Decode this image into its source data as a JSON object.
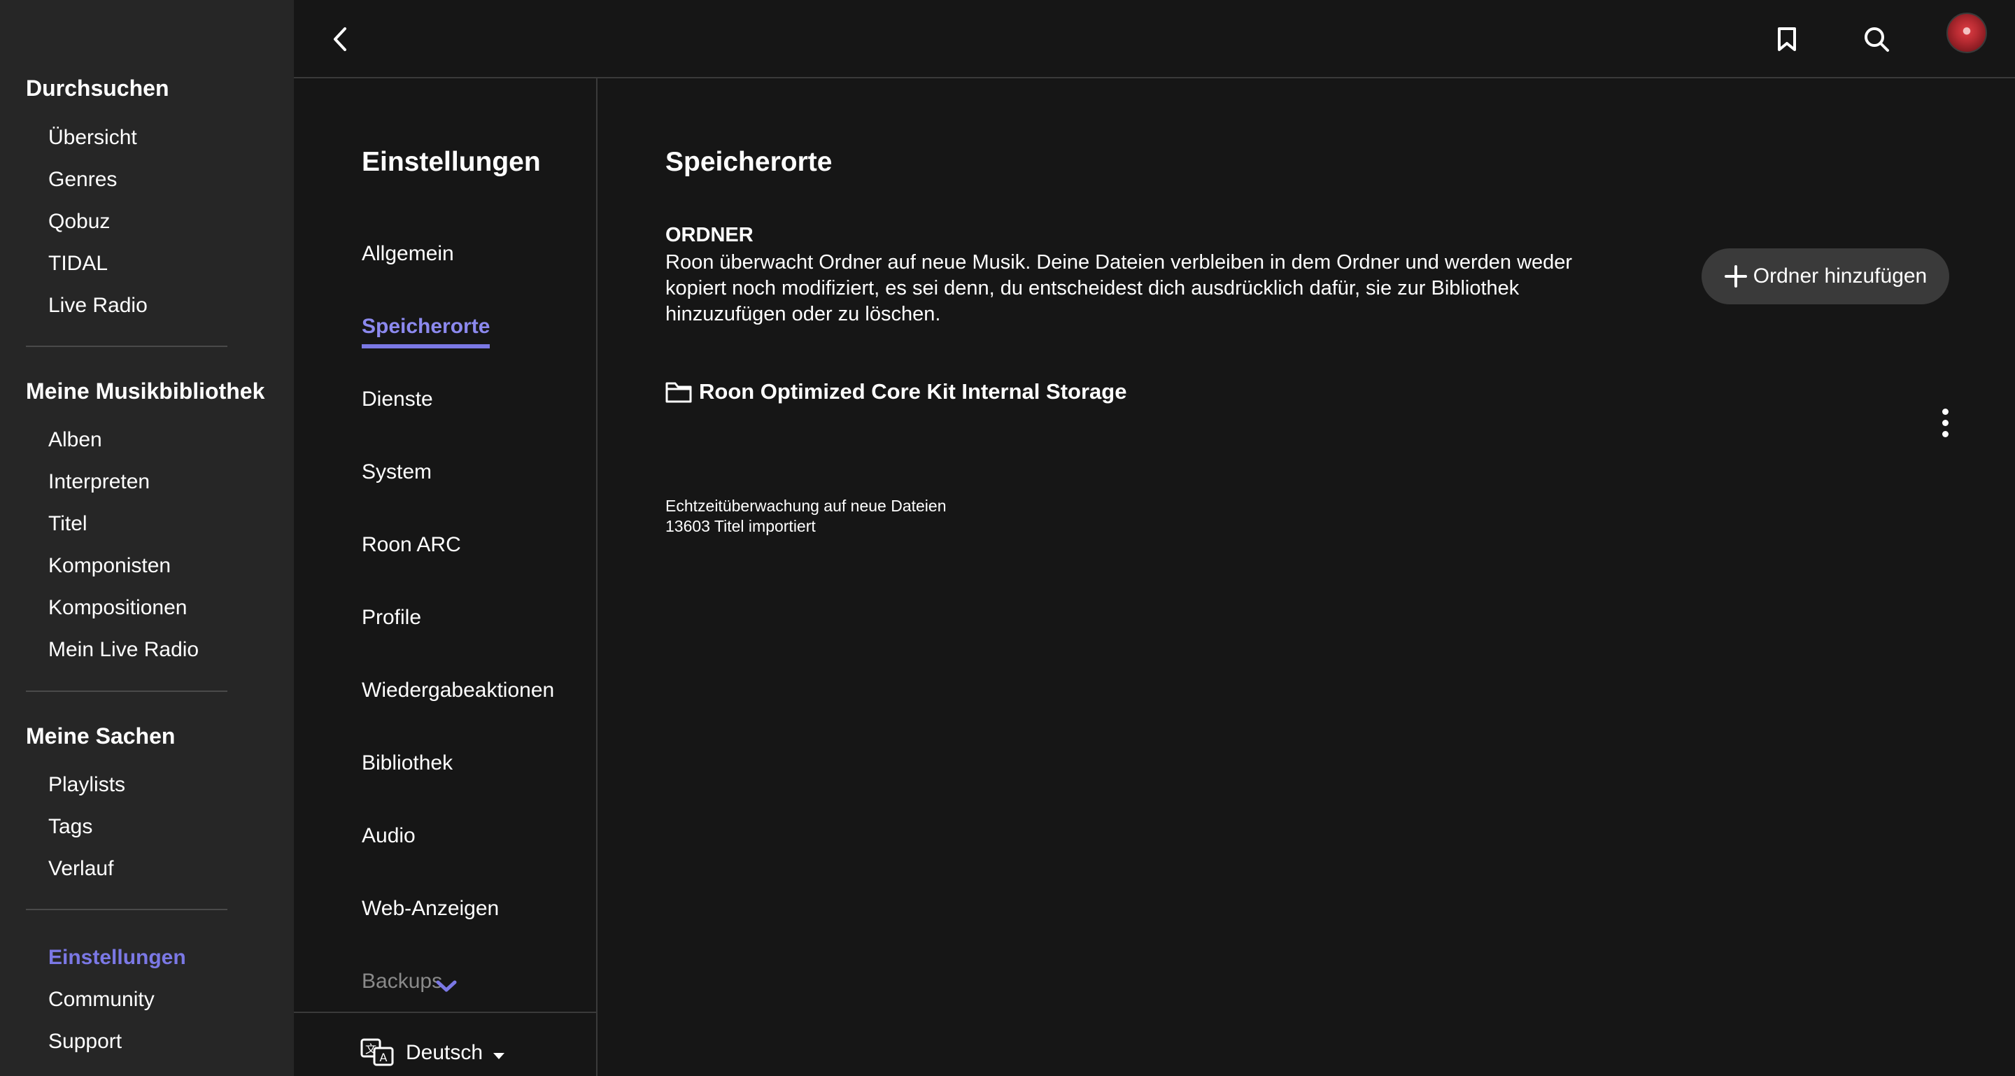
{
  "sidebar": {
    "browse_title": "Durchsuchen",
    "browse_items": [
      "Übersicht",
      "Genres",
      "Qobuz",
      "TIDAL",
      "Live Radio"
    ],
    "library_title": "Meine Musikbibliothek",
    "library_items": [
      "Alben",
      "Interpreten",
      "Titel",
      "Komponisten",
      "Kompositionen",
      "Mein Live Radio"
    ],
    "mystuff_title": "Meine Sachen",
    "mystuff_items": [
      "Playlists",
      "Tags",
      "Verlauf"
    ],
    "bottom_items": [
      "Einstellungen",
      "Community",
      "Support"
    ],
    "active_item": "Einstellungen"
  },
  "topbar": {
    "back_icon": "chevron-left-icon",
    "bookmark_icon": "bookmark-icon",
    "search_icon": "search-icon"
  },
  "settings": {
    "title": "Einstellungen",
    "items": [
      "Allgemein",
      "Speicherorte",
      "Dienste",
      "System",
      "Roon ARC",
      "Profile",
      "Wiedergabeaktionen",
      "Bibliothek",
      "Audio",
      "Web-Anzeigen",
      "Backups"
    ],
    "active_item": "Speicherorte",
    "language": "Deutsch"
  },
  "main": {
    "title": "Speicherorte",
    "folder_heading": "ORDNER",
    "folder_description": "Roon überwacht Ordner auf neue Musik. Deine Dateien verbleiben in dem Ordner und werden weder kopiert noch modifiziert, es sei denn, du entscheidest dich ausdrücklich dafür, sie zur Bibliothek hinzuzufügen oder zu löschen.",
    "add_button": "Ordner hinzufügen",
    "storage": {
      "name": "Roon Optimized Core Kit Internal Storage",
      "status": "Echtzeitüberwachung auf neue Dateien",
      "count": "13603 Titel importiert"
    }
  },
  "colors": {
    "accent": "#7b78e5",
    "sidebar_bg": "#262626",
    "main_bg": "#161616",
    "button_bg": "#3a3a3a"
  }
}
